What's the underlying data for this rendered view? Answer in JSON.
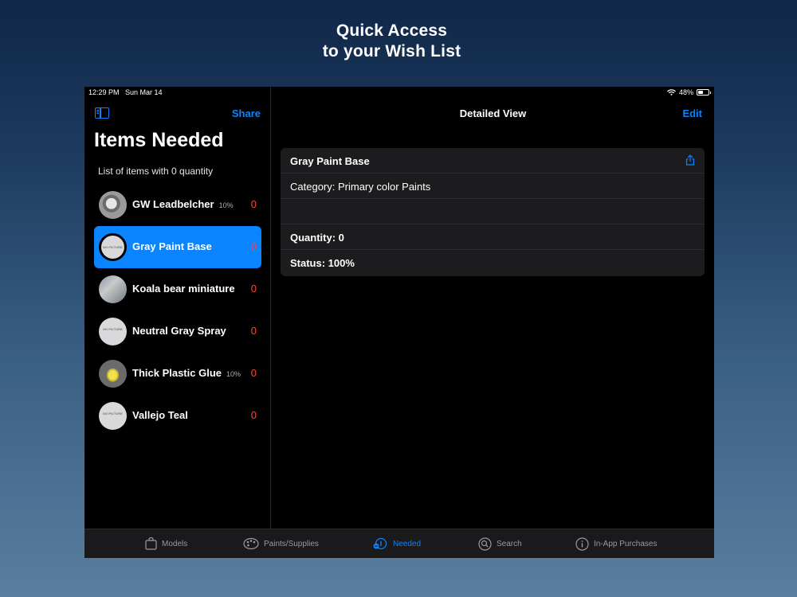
{
  "headline": {
    "line1": "Quick Access",
    "line2": "to your Wish List"
  },
  "status_bar": {
    "time": "12:29 PM",
    "date": "Sun Mar 14",
    "battery": "48%"
  },
  "sidebar": {
    "share_label": "Share",
    "title": "Items Needed",
    "subtitle": "List of items with 0 quantity",
    "no_picture_text": "NO PICTURE",
    "items": [
      {
        "name": "GW Leadbelcher",
        "percent": "10%",
        "qty": "0",
        "thumb": "photo"
      },
      {
        "name": "Gray Paint Base",
        "percent": "",
        "qty": "0",
        "thumb": "no-picture",
        "selected": true
      },
      {
        "name": "Koala bear miniature",
        "percent": "",
        "qty": "0",
        "thumb": "photo"
      },
      {
        "name": "Neutral Gray Spray",
        "percent": "",
        "qty": "0",
        "thumb": "no-picture"
      },
      {
        "name": "Thick Plastic Glue",
        "percent": "10%",
        "qty": "0",
        "thumb": "photo"
      },
      {
        "name": "Vallejo Teal",
        "percent": "",
        "qty": "0",
        "thumb": "no-picture"
      }
    ]
  },
  "detail": {
    "nav_title": "Detailed View",
    "edit_label": "Edit",
    "item_name": "Gray Paint Base",
    "category": "Category: Primary color Paints",
    "notes": "",
    "quantity": "Quantity: 0",
    "status": "Status: 100%"
  },
  "tabs": [
    {
      "label": "Models",
      "icon": "bag-icon"
    },
    {
      "label": "Paints/Supplies",
      "icon": "palette-icon"
    },
    {
      "label": "Needed",
      "icon": "needed-icon",
      "active": true
    },
    {
      "label": "Search",
      "icon": "search-icon"
    },
    {
      "label": "In-App Purchases",
      "icon": "info-icon"
    }
  ],
  "colors": {
    "accent": "#0a84ff",
    "quantity": "#ff453a",
    "background": "#000000",
    "card": "#1c1c1e"
  }
}
